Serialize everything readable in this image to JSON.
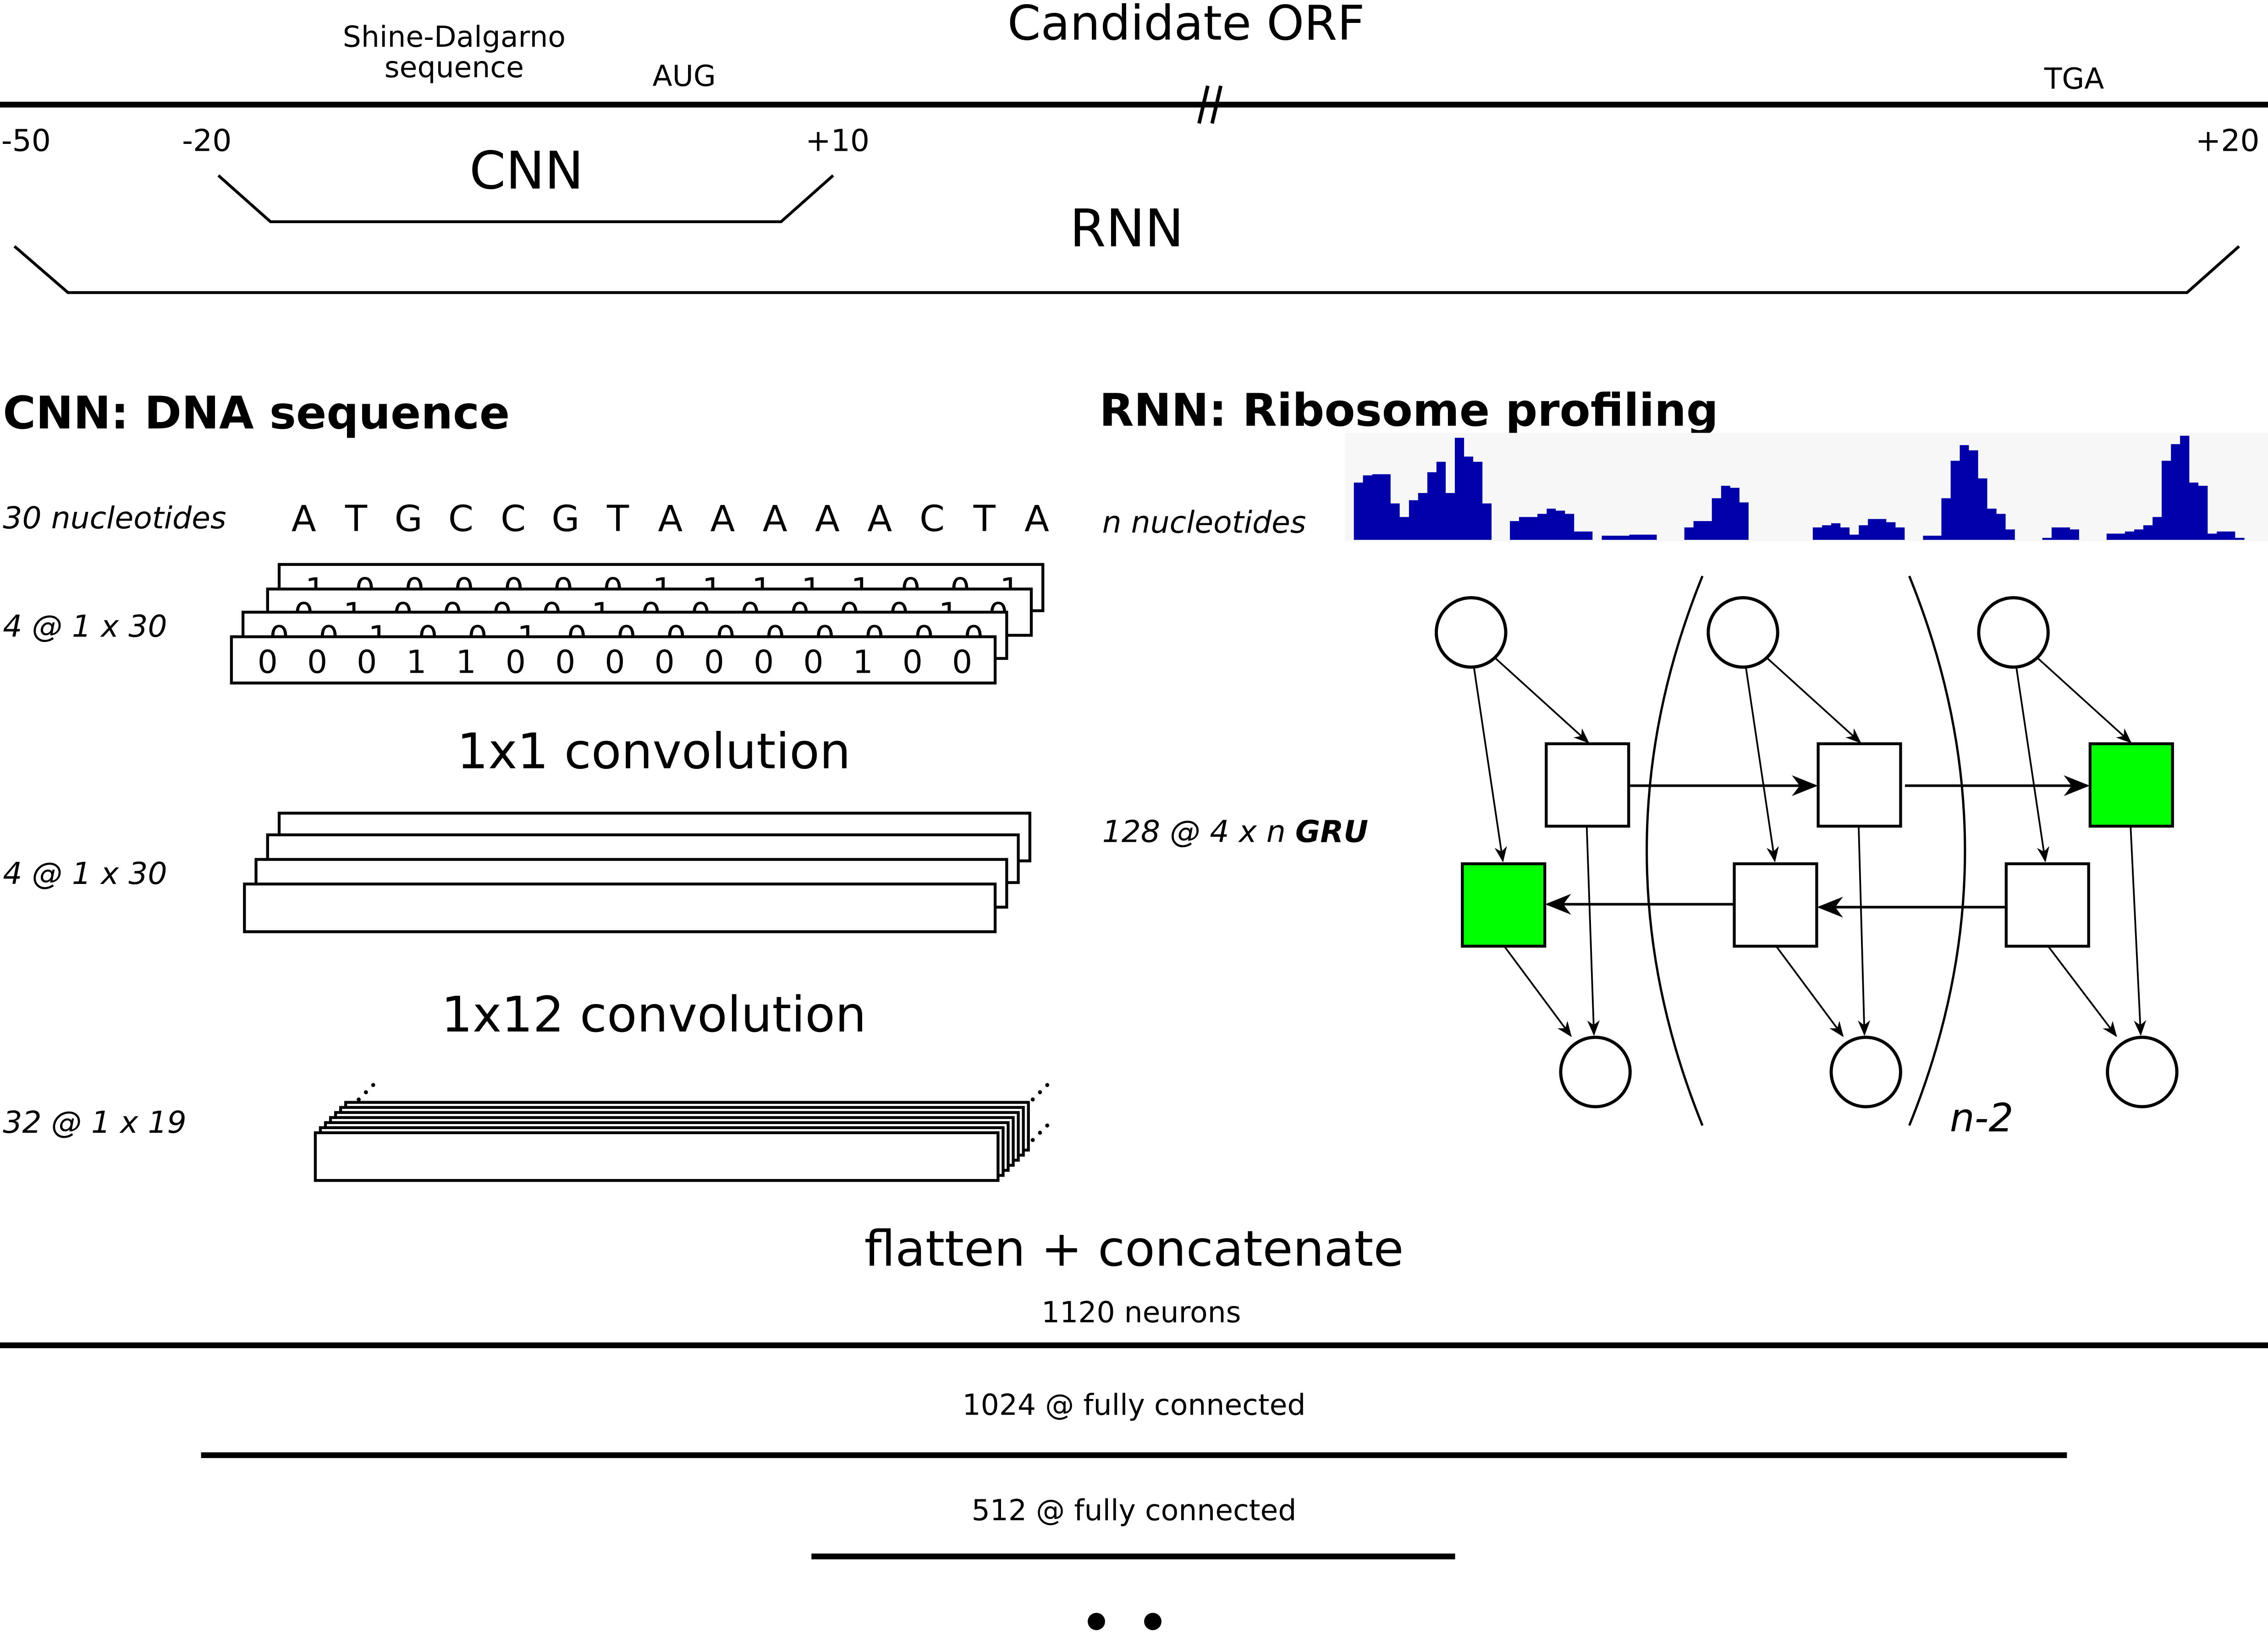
{
  "header": {
    "orf_title": "Candidate ORF",
    "shine_dalgarno_line1": "Shine-Dalgarno",
    "shine_dalgarno_line2": "sequence",
    "start_codon": "AUG",
    "stop_codon": "TGA",
    "break_mark": "//",
    "pos_minus50": "-50",
    "pos_minus20": "-20",
    "pos_plus10": "+10",
    "pos_plus20": "+20",
    "cnn_span_label": "CNN",
    "rnn_span_label": "RNN"
  },
  "cnn": {
    "title": "CNN: DNA sequence",
    "input_label": "30 nucleotides",
    "sequence": [
      "A",
      "T",
      "G",
      "C",
      "C",
      "G",
      "T",
      "A",
      "A",
      "A",
      "A",
      "A",
      "C",
      "T",
      "A"
    ],
    "onehot_label": "4 @ 1 x 30",
    "onehot_rows": [
      [
        1,
        0,
        0,
        0,
        0,
        0,
        0,
        1,
        1,
        1,
        1,
        1,
        0,
        0,
        1
      ],
      [
        0,
        1,
        0,
        0,
        0,
        0,
        1,
        0,
        0,
        0,
        0,
        0,
        0,
        1,
        0
      ],
      [
        0,
        0,
        1,
        0,
        0,
        1,
        0,
        0,
        0,
        0,
        0,
        0,
        0,
        0,
        0
      ],
      [
        0,
        0,
        0,
        1,
        1,
        0,
        0,
        0,
        0,
        0,
        0,
        0,
        1,
        0,
        0
      ]
    ],
    "conv1_label": "1x1 convolution",
    "conv1_output_label": "4 @ 1 x 30",
    "conv2_label": "1x12 convolution",
    "conv2_output_label": "32 @ 1 x 19"
  },
  "rnn": {
    "title": "RNN: Ribosome profiling",
    "input_label_italic": "n nucleotides",
    "gru_label_italic": "128 @ 4 x n ",
    "gru_label_bold": "GRU",
    "repeat_label": "n-2",
    "profile_color": "#0000aa",
    "profile_bg": "#f7f7f7",
    "gate_color": "#00ff00",
    "profile_values": [
      0.55,
      0.62,
      0.63,
      0.63,
      0.35,
      0.22,
      0.38,
      0.45,
      0.65,
      0.75,
      0.45,
      0.98,
      0.8,
      0.75,
      0.35,
      0,
      0,
      0.18,
      0.22,
      0.22,
      0.25,
      0.3,
      0.28,
      0.25,
      0.08,
      0.08,
      0,
      0.04,
      0.04,
      0.04,
      0.05,
      0.05,
      0.05,
      0,
      0,
      0,
      0.12,
      0.18,
      0.18,
      0.4,
      0.52,
      0.5,
      0.36,
      0,
      0,
      0,
      0,
      0,
      0,
      0,
      0.12,
      0.14,
      0.16,
      0.12,
      0.05,
      0.14,
      0.2,
      0.2,
      0.17,
      0.12,
      0,
      0,
      0.04,
      0.04,
      0.4,
      0.76,
      0.91,
      0.86,
      0.59,
      0.3,
      0.25,
      0.1,
      0,
      0,
      0,
      0.02,
      0.12,
      0.12,
      0.1,
      0,
      0,
      0,
      0.06,
      0.06,
      0.08,
      0.1,
      0.14,
      0.22,
      0.76,
      0.92,
      1.0,
      0.55,
      0.52,
      0.06,
      0.08,
      0.08,
      0.02,
      0
    ]
  },
  "merge": {
    "label": "flatten + concatenate",
    "neurons": "1120 neurons"
  },
  "dense": [
    {
      "label": "1024 @ fully connected"
    },
    {
      "label": "512 @ fully connected"
    }
  ],
  "continuation": "• •"
}
